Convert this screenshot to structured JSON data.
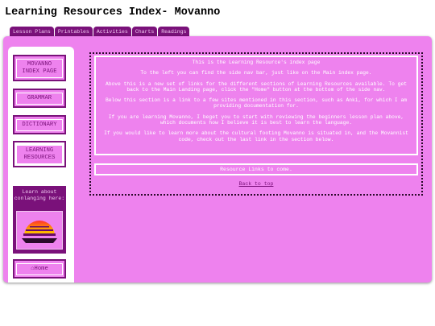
{
  "page": {
    "title": "Learning Resources Index- Movanno"
  },
  "tabs": [
    "Lesson Plans",
    "Printables",
    "Activities",
    "Charts",
    "Readings"
  ],
  "sidebar": {
    "items": [
      {
        "label": "MOVANNO INDEX PAGE"
      },
      {
        "label": "GRAMMAR"
      },
      {
        "label": "DICTIONARY"
      },
      {
        "label": "LEARNING RESOURCES"
      }
    ],
    "conlang_label": "Learn about conlanging here:",
    "home_label": "⌂Home"
  },
  "content": {
    "intro": [
      "This is the Learning Resource's index page",
      "To the left you can find the side nav bar, just like on the Main index page.",
      "Above this is a new set of links for the different sections of Learning Resources available. To get back to the Main Landing page, click the \"Home\" button at the bottom of the side nav.",
      "Below this section is a link to a few sites mentioned in this section, such as Anki, for which I am providing documentation for.",
      "If you are learning Movanno, I beget you to start with reviewing the beginners lesson plan above, which documents how I believe it is best to learn the language.",
      "If you would like to learn more about the cultural footing Movanno is situated in, and the Movannist code, check out the last link in the section below."
    ],
    "resources": "Resource Links to come.",
    "back_to_top": "Back to top"
  },
  "colors": {
    "accent": "#ee82ee",
    "dark": "#7a117a",
    "light": "#ffffff"
  }
}
